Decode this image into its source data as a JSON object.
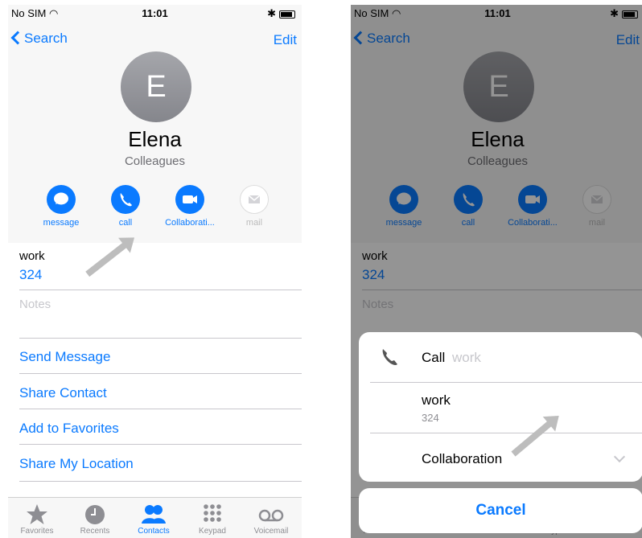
{
  "status": {
    "carrier": "No SIM",
    "time": "11:01"
  },
  "nav": {
    "back_label": "Search",
    "edit_label": "Edit"
  },
  "contact": {
    "initial": "E",
    "name": "Elena",
    "group": "Colleagues"
  },
  "actions": [
    {
      "label": "message",
      "icon": "message-icon"
    },
    {
      "label": "call",
      "icon": "phone-icon"
    },
    {
      "label": "Collaborati...",
      "icon": "video-icon"
    },
    {
      "label": "mail",
      "icon": "mail-icon"
    }
  ],
  "phone_field": {
    "label": "work",
    "value": "324"
  },
  "notes_placeholder": "Notes",
  "links": [
    "Send Message",
    "Share Contact",
    "Add to Favorites",
    "Share My Location"
  ],
  "tabs": [
    {
      "label": "Favorites",
      "icon": "star-icon"
    },
    {
      "label": "Recents",
      "icon": "clock-icon"
    },
    {
      "label": "Contacts",
      "icon": "contacts-icon",
      "active": true
    },
    {
      "label": "Keypad",
      "icon": "keypad-icon"
    },
    {
      "label": "Voicemail",
      "icon": "voicemail-icon"
    }
  ],
  "call_sheet": {
    "title": "Call",
    "title_sub": "work",
    "option_label": "work",
    "option_value": "324",
    "collab_label": "Collaboration",
    "cancel_label": "Cancel"
  },
  "colors": {
    "accent": "#0a7aff"
  }
}
